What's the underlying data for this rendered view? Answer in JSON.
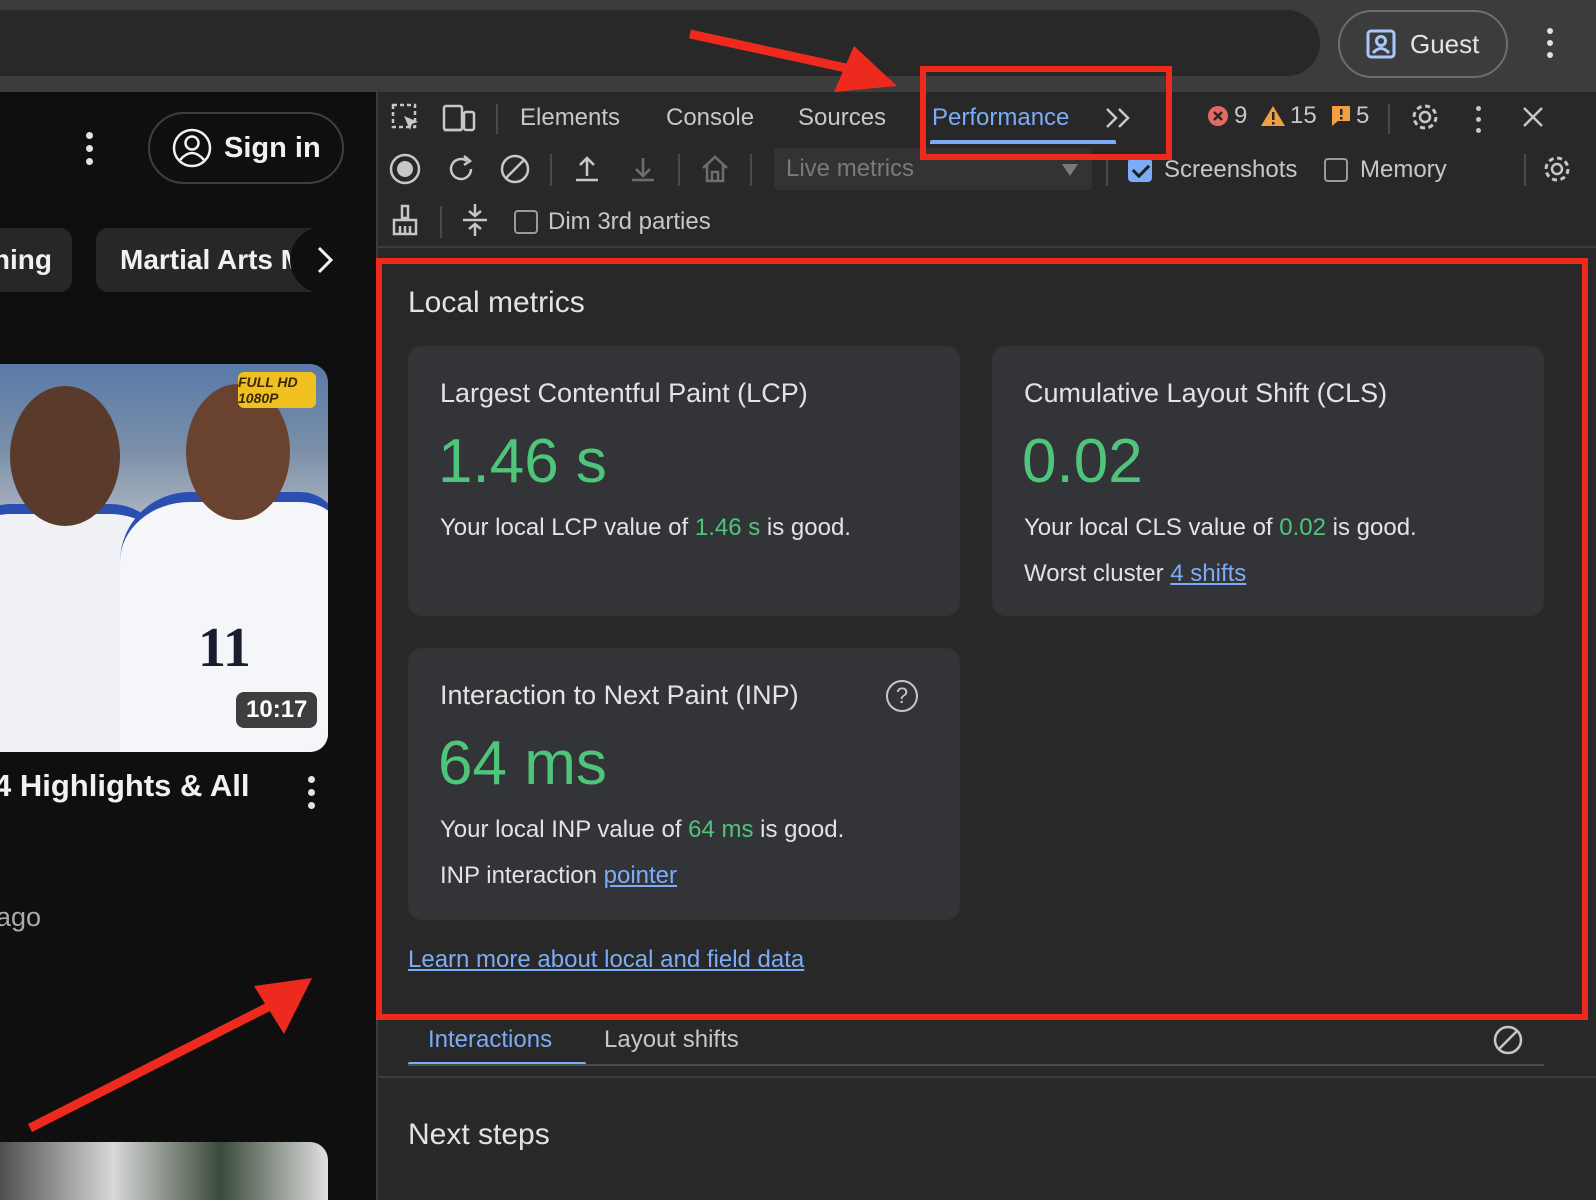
{
  "browser": {
    "guest_label": "Guest",
    "accent": "#7cacf8"
  },
  "page": {
    "signin_label": "Sign in",
    "chips": [
      "ning",
      "Martial Arts M"
    ],
    "video": {
      "badge": "FULL HD 1080P",
      "jersey_number": "11",
      "duration": "10:17",
      "title": "4 Highlights & All",
      "meta": "ago"
    }
  },
  "devtools": {
    "tabs": [
      "Elements",
      "Console",
      "Sources",
      "Performance"
    ],
    "active_tab": "Performance",
    "counts": {
      "errors": "9",
      "warnings": "15",
      "issues": "5"
    },
    "toolbar": {
      "live_select": "Live metrics",
      "screenshots_label": "Screenshots",
      "screenshots_checked": true,
      "memory_label": "Memory",
      "memory_checked": false,
      "dim_label": "Dim 3rd parties",
      "dim_checked": false
    },
    "local_metrics": {
      "title": "Local metrics",
      "lcp": {
        "title": "Largest Contentful Paint (LCP)",
        "value": "1.46 s",
        "desc_prefix": "Your local LCP value of ",
        "desc_value": "1.46 s",
        "desc_suffix": " is good."
      },
      "cls": {
        "title": "Cumulative Layout Shift (CLS)",
        "value": "0.02",
        "desc_prefix": "Your local CLS value of ",
        "desc_value": "0.02",
        "desc_suffix": " is good.",
        "extra_label": "Worst cluster ",
        "extra_link": "4 shifts"
      },
      "inp": {
        "title": "Interaction to Next Paint (INP)",
        "value": "64 ms",
        "desc_prefix": "Your local INP value of ",
        "desc_value": "64 ms",
        "desc_suffix": " is good.",
        "extra_label": "INP interaction ",
        "extra_link": "pointer"
      },
      "learn_more": "Learn more about local and field data"
    },
    "subtabs": [
      "Interactions",
      "Layout shifts"
    ],
    "active_subtab": "Interactions",
    "next_steps_title": "Next steps",
    "good_color": "#4ec57a"
  },
  "annotation_color": "#ee2a1e"
}
